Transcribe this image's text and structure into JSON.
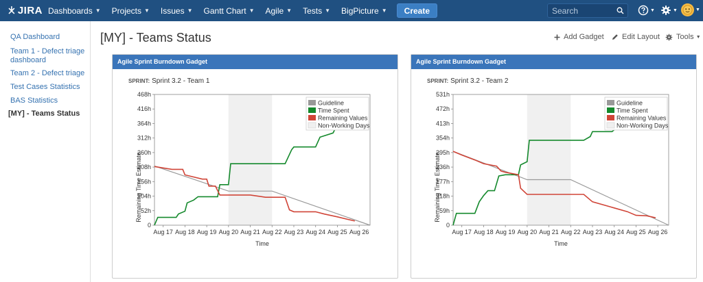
{
  "nav": {
    "logo_text": "JIRA",
    "items": [
      {
        "label": "Dashboards"
      },
      {
        "label": "Projects"
      },
      {
        "label": "Issues"
      },
      {
        "label": "Gantt Chart"
      },
      {
        "label": "Agile"
      },
      {
        "label": "Tests"
      },
      {
        "label": "BigPicture"
      }
    ],
    "create_label": "Create",
    "search_placeholder": "Search"
  },
  "sidebar": {
    "items": [
      {
        "label": "QA Dashboard"
      },
      {
        "label": "Team 1 - Defect triage dashboard"
      },
      {
        "label": "Team 2 - Defect triage"
      },
      {
        "label": "Test Cases Statistics"
      },
      {
        "label": "BAS Statistics"
      },
      {
        "label": "[MY] - Teams Status"
      }
    ]
  },
  "page": {
    "title": "[MY] - Teams Status",
    "add_gadget": "Add Gadget",
    "edit_layout": "Edit Layout",
    "tools": "Tools"
  },
  "gadgets": [
    {
      "title": "Agile Sprint Burndown Gadget",
      "sprint_label": "SPRINT:",
      "sprint_name": "Sprint 3.2 - Team 1"
    },
    {
      "title": "Agile Sprint Burndown Gadget",
      "sprint_label": "SPRINT:",
      "sprint_name": "Sprint 3.2 - Team 2"
    }
  ],
  "colors": {
    "nav_bg": "#205081",
    "guideline": "#999999",
    "time_spent": "#14892c",
    "remaining": "#d04437",
    "non_working": "#f0f0f0"
  },
  "chart_data": [
    {
      "type": "line",
      "title": "Sprint 3.2 - Team 1",
      "xlabel": "Time",
      "ylabel": "Remaining Time Estimate",
      "x_ticks": [
        "Aug 17",
        "Aug 18",
        "Aug 19",
        "Aug 20",
        "Aug 21",
        "Aug 22",
        "Aug 23",
        "Aug 24",
        "Aug 25",
        "Aug 26"
      ],
      "y_ticks": [
        "0",
        "52h",
        "104h",
        "156h",
        "208h",
        "260h",
        "312h",
        "364h",
        "416h",
        "468h"
      ],
      "xlim": [
        16.6,
        26.5
      ],
      "ylim": [
        0,
        468
      ],
      "non_working": [
        [
          20,
          22
        ]
      ],
      "legend": [
        "Guideline",
        "Time Spent",
        "Remaining Values",
        "Non-Working Days"
      ],
      "series": [
        {
          "name": "Guideline",
          "points": [
            [
              16.6,
              212
            ],
            [
              20,
              122
            ],
            [
              22,
              122
            ],
            [
              26.5,
              0
            ]
          ]
        },
        {
          "name": "Time Spent",
          "points": [
            [
              16.6,
              0
            ],
            [
              16.75,
              28
            ],
            [
              17.6,
              28
            ],
            [
              17.7,
              40
            ],
            [
              18.0,
              50
            ],
            [
              18.1,
              80
            ],
            [
              18.4,
              90
            ],
            [
              18.6,
              102
            ],
            [
              19.5,
              102
            ],
            [
              19.6,
              145
            ],
            [
              20.0,
              145
            ],
            [
              20.1,
              220
            ],
            [
              22.6,
              220
            ],
            [
              22.9,
              270
            ],
            [
              23.0,
              280
            ],
            [
              24.0,
              280
            ],
            [
              24.2,
              315
            ],
            [
              24.8,
              330
            ],
            [
              25.0,
              360
            ],
            [
              25.3,
              380
            ]
          ]
        },
        {
          "name": "Remaining Values",
          "points": [
            [
              16.6,
              210
            ],
            [
              17.4,
              200
            ],
            [
              17.9,
              200
            ],
            [
              18.0,
              180
            ],
            [
              18.8,
              165
            ],
            [
              19.0,
              165
            ],
            [
              19.1,
              140
            ],
            [
              19.4,
              140
            ],
            [
              19.6,
              108
            ],
            [
              21.0,
              108
            ],
            [
              21.7,
              100
            ],
            [
              22.6,
              100
            ],
            [
              22.8,
              55
            ],
            [
              23.0,
              48
            ],
            [
              24.0,
              48
            ],
            [
              24.4,
              40
            ],
            [
              25.0,
              30
            ],
            [
              25.8,
              15
            ]
          ]
        }
      ]
    },
    {
      "type": "line",
      "title": "Sprint 3.2 - Team 2",
      "xlabel": "Time",
      "ylabel": "Remaining Time Estimate",
      "x_ticks": [
        "Aug 17",
        "Aug 18",
        "Aug 19",
        "Aug 20",
        "Aug 21",
        "Aug 22",
        "Aug 23",
        "Aug 24",
        "Aug 25",
        "Aug 26"
      ],
      "y_ticks": [
        "0",
        "59h",
        "118h",
        "177h",
        "236h",
        "295h",
        "354h",
        "413h",
        "472h",
        "531h"
      ],
      "xlim": [
        16.6,
        26.5
      ],
      "ylim": [
        0,
        531
      ],
      "non_working": [
        [
          20,
          22
        ]
      ],
      "legend": [
        "Guideline",
        "Time Spent",
        "Remaining Values",
        "Non-Working Days"
      ],
      "series": [
        {
          "name": "Guideline",
          "points": [
            [
              16.6,
              300
            ],
            [
              20,
              185
            ],
            [
              22,
              185
            ],
            [
              26.5,
              0
            ]
          ]
        },
        {
          "name": "Time Spent",
          "points": [
            [
              16.6,
              0
            ],
            [
              16.75,
              48
            ],
            [
              17.6,
              48
            ],
            [
              17.8,
              95
            ],
            [
              18.0,
              120
            ],
            [
              18.2,
              140
            ],
            [
              18.5,
              140
            ],
            [
              18.7,
              200
            ],
            [
              19.0,
              205
            ],
            [
              19.6,
              205
            ],
            [
              19.7,
              245
            ],
            [
              20.0,
              258
            ],
            [
              20.1,
              345
            ],
            [
              22.6,
              345
            ],
            [
              22.9,
              360
            ],
            [
              23.0,
              380
            ],
            [
              23.9,
              380
            ],
            [
              24.1,
              395
            ],
            [
              24.3,
              420
            ],
            [
              24.6,
              430
            ],
            [
              24.8,
              465
            ]
          ]
        },
        {
          "name": "Remaining Values",
          "points": [
            [
              16.6,
              300
            ],
            [
              17.0,
              285
            ],
            [
              17.6,
              265
            ],
            [
              18.0,
              250
            ],
            [
              18.6,
              240
            ],
            [
              18.8,
              220
            ],
            [
              19.0,
              215
            ],
            [
              19.6,
              205
            ],
            [
              19.7,
              150
            ],
            [
              20.0,
              125
            ],
            [
              22.6,
              125
            ],
            [
              23.0,
              95
            ],
            [
              23.8,
              75
            ],
            [
              24.0,
              70
            ],
            [
              24.6,
              55
            ],
            [
              25.0,
              40
            ],
            [
              25.5,
              38
            ],
            [
              25.9,
              30
            ]
          ]
        }
      ]
    }
  ]
}
